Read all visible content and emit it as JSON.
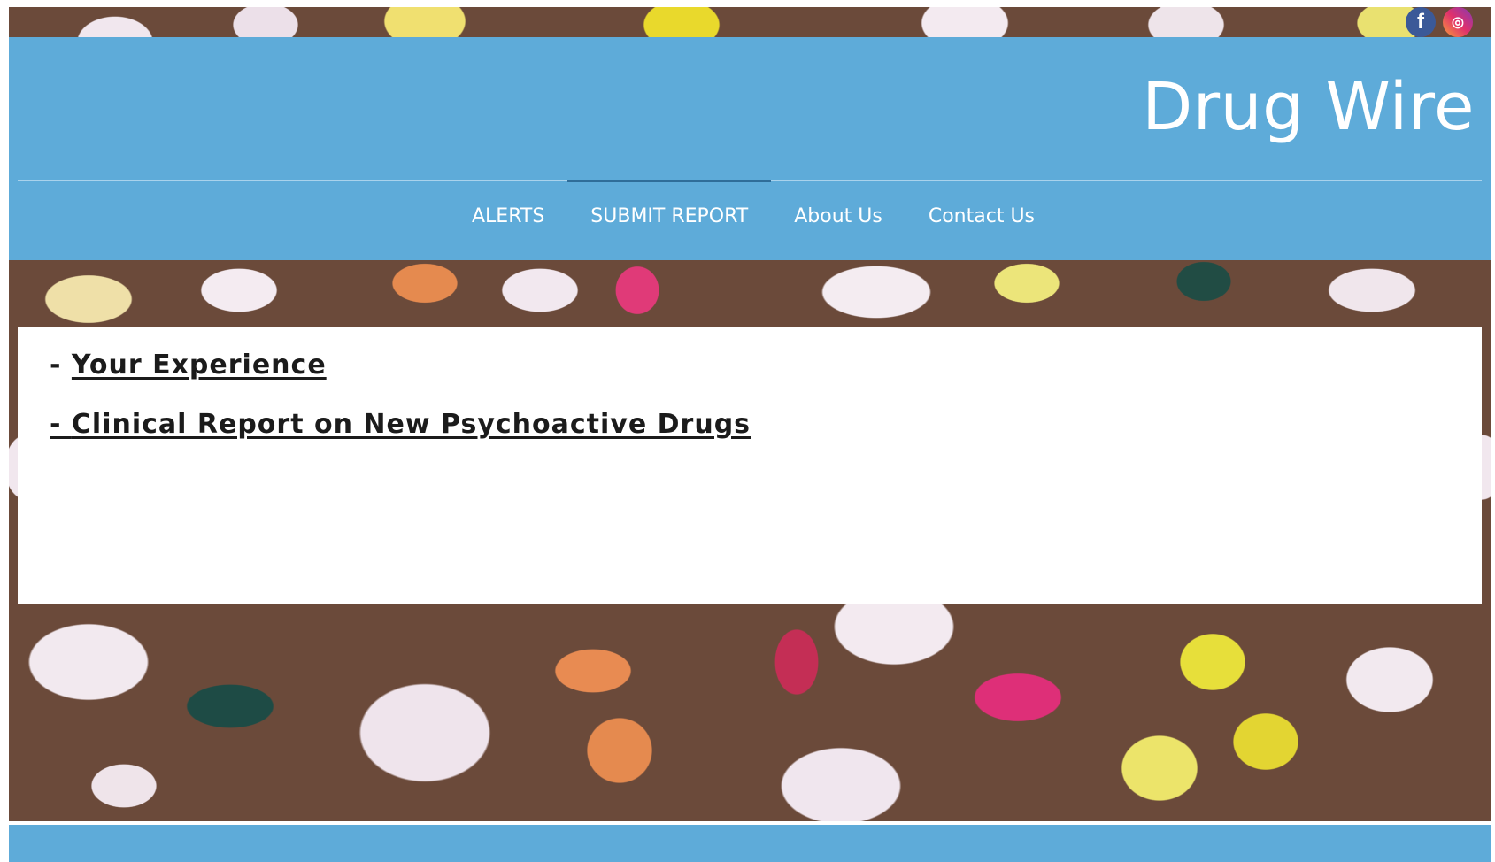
{
  "site": {
    "title": "Drug Wire"
  },
  "social": {
    "facebook_glyph": "f",
    "instagram_glyph": "◎"
  },
  "nav": {
    "items": [
      {
        "label": "ALERTS",
        "active": false
      },
      {
        "label": "SUBMIT REPORT",
        "active": true
      },
      {
        "label": "About Us",
        "active": false
      },
      {
        "label": "Contact Us",
        "active": false
      }
    ]
  },
  "content": {
    "links": [
      {
        "dash": "- ",
        "label": "Your Experience"
      },
      {
        "dash": "- ",
        "label": "Clinical Report on New Psychoactive Drugs"
      }
    ]
  },
  "colors": {
    "header": "#5eabd9",
    "nav_active_indicator": "#2f6d99",
    "card": "#ffffff",
    "link_text": "#1b1b1b"
  },
  "icons": {
    "facebook": "facebook-icon",
    "instagram": "instagram-icon"
  }
}
